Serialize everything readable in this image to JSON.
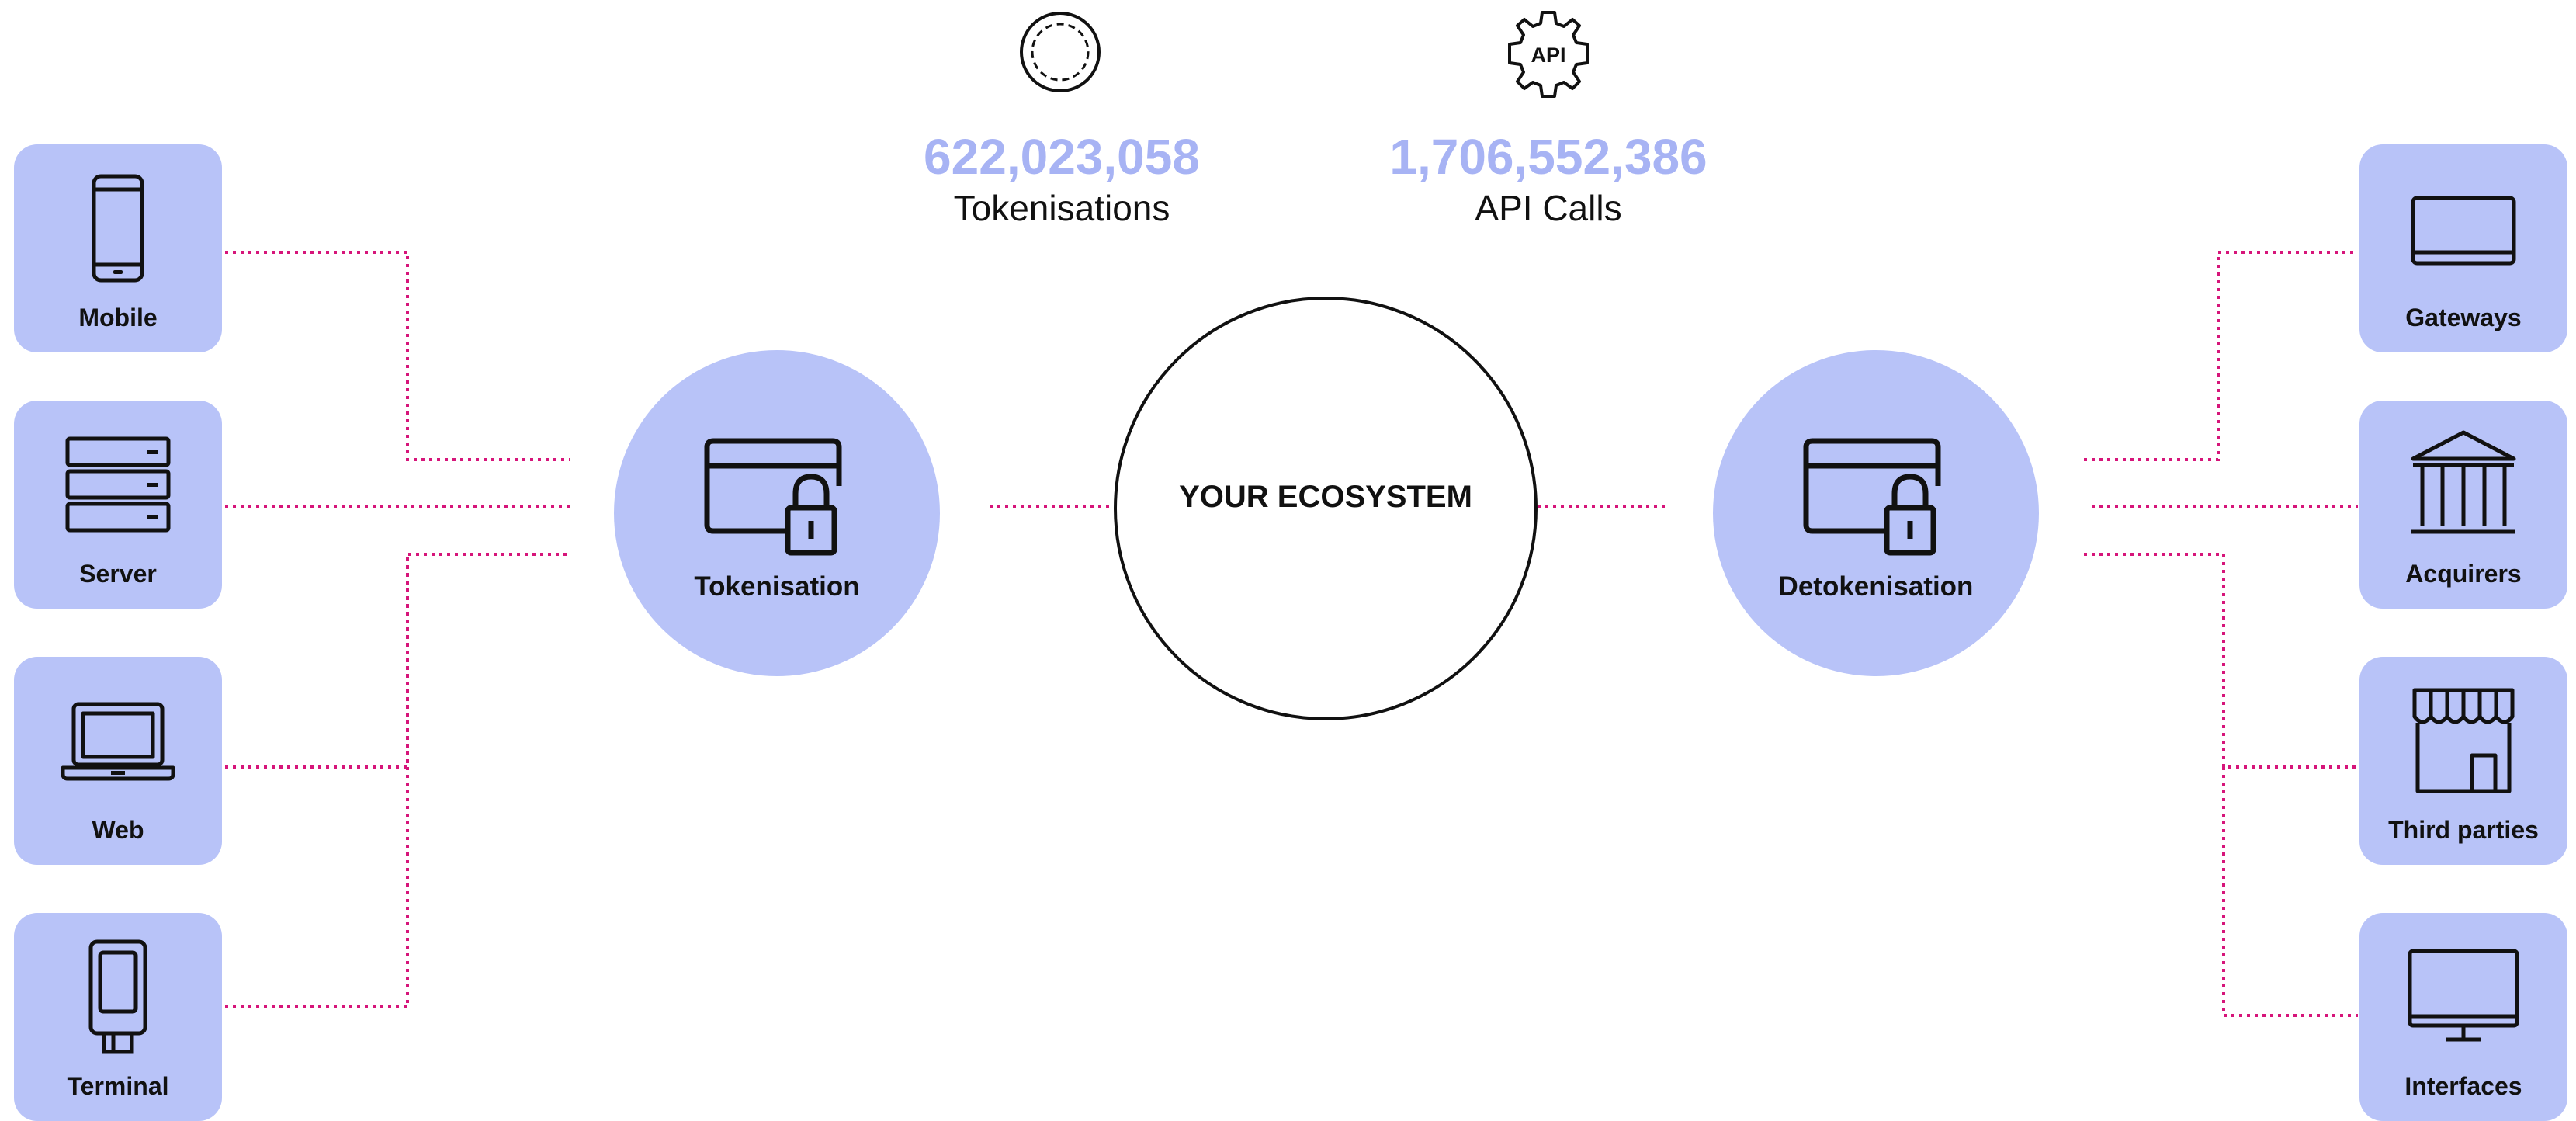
{
  "stats": [
    {
      "value": "622,023,058",
      "caption": "Tokenisations",
      "icon": "token-circle-icon"
    },
    {
      "value": "1,706,552,386",
      "caption": "API Calls",
      "icon": "api-gear-icon",
      "icon_text": "API"
    }
  ],
  "center": {
    "label": "YOUR ECOSYSTEM"
  },
  "hubs": {
    "left": {
      "label": "Tokenisation",
      "icon": "card-lock-icon"
    },
    "right": {
      "label": "Detokenisation",
      "icon": "card-lock-icon"
    }
  },
  "sources": [
    {
      "label": "Mobile",
      "icon": "mobile-phone-icon"
    },
    {
      "label": "Server",
      "icon": "server-icon"
    },
    {
      "label": "Web",
      "icon": "laptop-icon"
    },
    {
      "label": "Terminal",
      "icon": "terminal-icon"
    }
  ],
  "destinations": [
    {
      "label": "Gateways",
      "icon": "gateway-device-icon"
    },
    {
      "label": "Acquirers",
      "icon": "bank-icon"
    },
    {
      "label": "Third parties",
      "icon": "storefront-icon"
    },
    {
      "label": "Interfaces",
      "icon": "monitor-icon"
    }
  ],
  "colors": {
    "card_fill": "#b8c3f8",
    "stat_number": "#a7b3f4",
    "connector": "#d6157a",
    "outline": "#111111"
  }
}
